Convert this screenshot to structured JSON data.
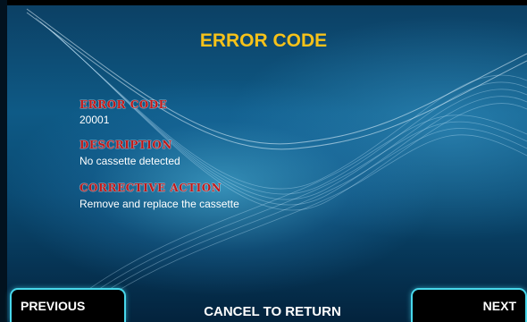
{
  "screen": {
    "title": "ERROR CODE",
    "sections": [
      {
        "label": "ERROR CODE",
        "value": "20001"
      },
      {
        "label": "DESCRIPTION",
        "value": "No cassette detected"
      },
      {
        "label": "CORRECTIVE ACTION",
        "value": "Remove and replace the cassette"
      }
    ]
  },
  "buttons": {
    "previous": "PREVIOUS",
    "next": "NEXT",
    "cancel": "CANCEL TO RETURN"
  },
  "colors": {
    "title": "#f6c21a",
    "label": "#c01818",
    "button_border": "#48d8ec"
  }
}
